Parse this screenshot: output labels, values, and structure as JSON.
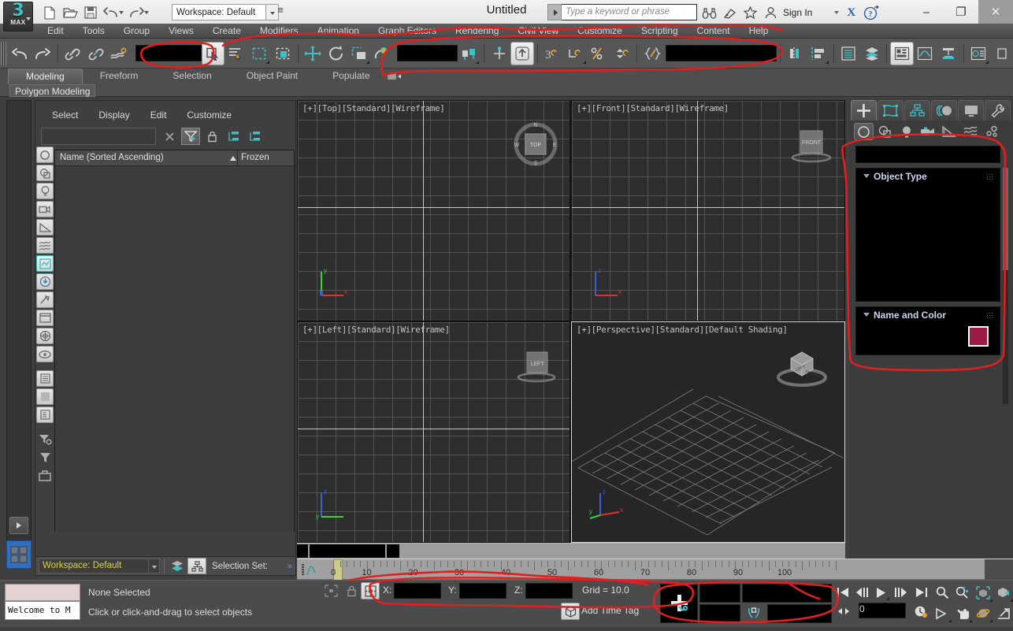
{
  "app": {
    "title": "Untitled",
    "logo_number": "3",
    "logo_text": "MAX",
    "workspace_value": "Workspace: Default",
    "search_placeholder": "Type a keyword or phrase",
    "sign_in": "Sign In",
    "x_logo": "X"
  },
  "window_buttons": {
    "minimize": "–",
    "maximize": "❐",
    "close": "✕"
  },
  "quick_access": [
    {
      "name": "new-file-icon",
      "label": "New"
    },
    {
      "name": "open-file-icon",
      "label": "Open"
    },
    {
      "name": "save-file-icon",
      "label": "Save"
    },
    {
      "name": "undo-icon",
      "label": "Undo"
    },
    {
      "name": "redo-icon",
      "label": "Redo"
    }
  ],
  "menu": [
    "Edit",
    "Tools",
    "Group",
    "Views",
    "Create",
    "Modifiers",
    "Animation",
    "Graph Editors",
    "Rendering",
    "Civil View",
    "Customize",
    "Scripting",
    "Content",
    "Help"
  ],
  "ribbon": {
    "tabs": [
      {
        "label": "Modeling",
        "selected": true
      },
      {
        "label": "Freeform",
        "selected": false
      },
      {
        "label": "Selection",
        "selected": false
      },
      {
        "label": "Object Paint",
        "selected": false
      },
      {
        "label": "Populate",
        "selected": false
      }
    ],
    "subtab": "Polygon Modeling"
  },
  "explorer": {
    "menu": [
      "Select",
      "Display",
      "Edit",
      "Customize"
    ],
    "filter_value": "",
    "columns": [
      "Name (Sorted Ascending)",
      "Frozen"
    ],
    "rows": [],
    "workspace_value": "Workspace: Default",
    "selection_set_label": "Selection Set:",
    "tools": [
      {
        "name": "clear-filter-icon"
      },
      {
        "name": "filter-funnel-icon",
        "active": true
      },
      {
        "name": "lock-icon"
      },
      {
        "name": "expand-all-icon"
      },
      {
        "name": "collapse-all-icon"
      }
    ],
    "side_buttons": [
      {
        "name": "display-none-icon"
      },
      {
        "name": "display-geometry-icon"
      },
      {
        "name": "display-lights-icon"
      },
      {
        "name": "display-cameras-icon"
      },
      {
        "name": "display-helpers-icon"
      },
      {
        "name": "display-spacewarps-icon"
      },
      {
        "name": "display-shapes-icon",
        "selected": true
      },
      {
        "name": "display-bones-icon"
      },
      {
        "name": "display-particles-icon"
      },
      {
        "name": "display-containers-icon"
      },
      {
        "name": "display-groups-icon"
      },
      {
        "name": "display-xrefs-icon"
      },
      {
        "name": "list-view-icon"
      },
      {
        "name": "panel-view-icon"
      },
      {
        "name": "layer-view-icon"
      },
      {
        "name": "filter-settings-icon"
      },
      {
        "name": "filter-apply-icon"
      },
      {
        "name": "toolbox-icon"
      }
    ]
  },
  "viewports": [
    {
      "name": "viewport-top",
      "label": "[+][Top][Standard][Wireframe]",
      "active": false
    },
    {
      "name": "viewport-front",
      "label": "[+][Front][Standard][Wireframe]",
      "active": false
    },
    {
      "name": "viewport-left",
      "label": "[+][Left][Standard][Wireframe]",
      "active": false
    },
    {
      "name": "viewport-perspective",
      "label": "[+][Perspective][Standard][Default Shading]",
      "active": true
    }
  ],
  "viewcube": {
    "top": "TOP",
    "front": "FRONT",
    "left": "LEFT",
    "compass": [
      "N",
      "E",
      "S",
      "W"
    ]
  },
  "command_panel": {
    "tabs": [
      {
        "name": "create-tab",
        "selected": true
      },
      {
        "name": "modify-tab",
        "selected": false
      },
      {
        "name": "hierarchy-tab",
        "selected": false
      },
      {
        "name": "motion-tab",
        "selected": false
      },
      {
        "name": "display-tab",
        "selected": false
      },
      {
        "name": "utilities-tab",
        "selected": false
      }
    ],
    "categories": [
      {
        "name": "geometry-category",
        "selected": true
      },
      {
        "name": "shapes-category",
        "selected": false
      },
      {
        "name": "lights-category",
        "selected": false
      },
      {
        "name": "cameras-category",
        "selected": false
      },
      {
        "name": "helpers-category",
        "selected": false
      },
      {
        "name": "spacewarps-category",
        "selected": false
      },
      {
        "name": "systems-category",
        "selected": false
      }
    ],
    "dropdown_value": "",
    "rollouts": [
      {
        "title": "Object Type"
      },
      {
        "title": "Name and Color"
      }
    ],
    "object_color": "#9e1b48"
  },
  "timebar": {
    "ticks": [
      "0",
      "10",
      "20",
      "30",
      "40",
      "50",
      "60",
      "70",
      "80",
      "90",
      "100"
    ],
    "current_frame": "0"
  },
  "status": {
    "maxscript_listener": "Welcome to M",
    "selection": "None Selected",
    "prompt": "Click or click-and-drag to select objects",
    "x_label": "X:",
    "x_value": "",
    "y_label": "Y:",
    "y_value": "",
    "z_label": "Z:",
    "z_value": "",
    "grid": "Grid = 10.0",
    "add_time_tag": "Add Time Tag"
  },
  "animation": {
    "auto_key": "",
    "set_key": "",
    "key_filters": "",
    "selection_list": ""
  },
  "playback_buttons": [
    {
      "name": "go-to-start-button"
    },
    {
      "name": "previous-frame-button"
    },
    {
      "name": "play-animation-button"
    },
    {
      "name": "next-frame-button"
    },
    {
      "name": "go-to-end-button"
    },
    {
      "name": "time-configuration-button"
    }
  ],
  "nav_buttons": [
    {
      "name": "zoom-button"
    },
    {
      "name": "zoom-all-button"
    },
    {
      "name": "zoom-extents-button"
    },
    {
      "name": "zoom-region-button"
    },
    {
      "name": "field-of-view-button"
    },
    {
      "name": "pan-view-button"
    },
    {
      "name": "orbit-button"
    },
    {
      "name": "maximize-viewport-toggle-button"
    }
  ],
  "colors": {
    "accent_teal": "#3fbfc6",
    "annotation_red": "#e02020",
    "object_color": "#9e1b48",
    "workspace_yellow": "#d8d23c"
  }
}
